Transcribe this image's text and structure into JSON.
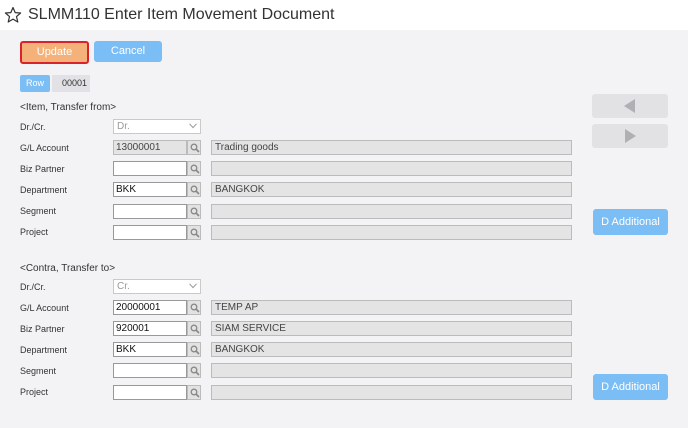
{
  "app": {
    "title": "SLMM110 Enter Item Movement Document"
  },
  "toolbar": {
    "update_label": "Update",
    "cancel_label": "Cancel"
  },
  "row_selector": {
    "label": "Row",
    "value": "00001"
  },
  "from_section": {
    "heading": "<Item, Transfer from>",
    "drcr": {
      "label": "Dr./Cr.",
      "value": "Dr."
    },
    "gl_account": {
      "label": "G/L Account",
      "value": "13000001",
      "desc": "Trading goods"
    },
    "biz_partner": {
      "label": "Biz Partner",
      "value": "",
      "desc": ""
    },
    "department": {
      "label": "Department",
      "value": "BKK",
      "desc": "BANGKOK"
    },
    "segment": {
      "label": "Segment",
      "value": "",
      "desc": ""
    },
    "project": {
      "label": "Project",
      "value": "",
      "desc": ""
    },
    "additional_label": "D Additional"
  },
  "to_section": {
    "heading": "<Contra, Transfer to>",
    "drcr": {
      "label": "Dr./Cr.",
      "value": "Cr."
    },
    "gl_account": {
      "label": "G/L Account",
      "value": "20000001",
      "desc": "TEMP AP"
    },
    "biz_partner": {
      "label": "Biz Partner",
      "value": "920001",
      "desc": "SIAM SERVICE"
    },
    "department": {
      "label": "Department",
      "value": "BKK",
      "desc": "BANGKOK"
    },
    "segment": {
      "label": "Segment",
      "value": "",
      "desc": ""
    },
    "project": {
      "label": "Project",
      "value": "",
      "desc": ""
    },
    "additional_label": "D Additional"
  },
  "icons": {
    "favorite": "star-outline-icon",
    "lookup": "magnifier-icon",
    "prev": "triangle-left-icon",
    "next": "triangle-right-icon",
    "dropdown": "chevron-down-icon"
  },
  "colors": {
    "accent_blue": "#7bbdf5",
    "update_orange": "#f4b27a",
    "focus_red": "#d9222a",
    "panel_bg": "#f3f3f6"
  }
}
